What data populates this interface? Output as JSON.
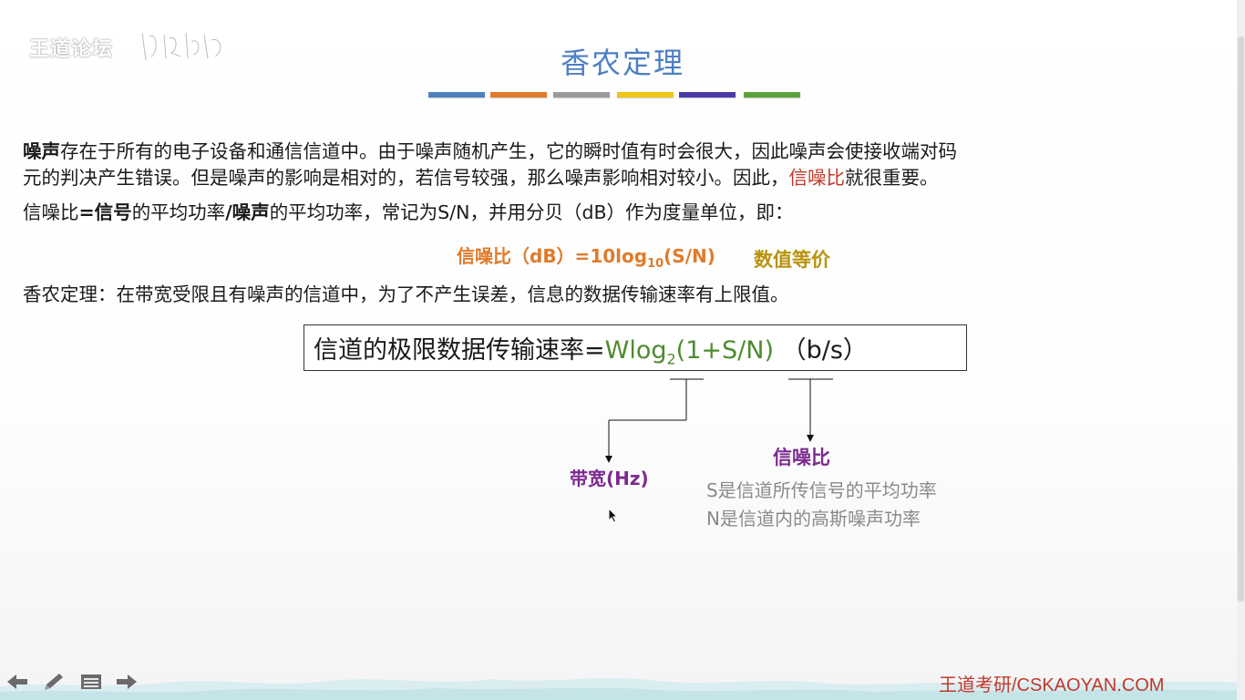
{
  "watermark": {
    "text": "王道论坛"
  },
  "title": "香农定理",
  "title_bar_colors": [
    "#4f81bd",
    "#e07b2a",
    "#9b9b9b",
    "#f0c419",
    "#4a3ca8",
    "#5ba33b"
  ],
  "paragraph1": {
    "term": "噪声",
    "rest_line1": "存在于所有的电子设备和通信信道中。由于噪声随机产生，它的瞬时值有时会很大，因此噪声会使接收端对码",
    "line2_pre": "元的判决产生错误。但是噪声的影响是相对的，若信号较强，那么噪声影响相对较小。因此，",
    "line2_highlight": "信噪比",
    "line2_post": "就很重要。"
  },
  "paragraph2": {
    "p1": "信噪比",
    "b1": "=信号",
    "p2": "的平均功率",
    "b2": "/噪声",
    "p3": "的平均功率，常记为S/N，并用分贝（dB）作为度量单位，即："
  },
  "formula_db": {
    "main": "信噪比（dB）=10log",
    "sub": "10",
    "tail": "(S/N)"
  },
  "equivalent_label": "数值等价",
  "paragraph3": "香农定理：在带宽受限且有噪声的信道中，为了不产生误差，信息的数据传输速率有上限值。",
  "shannon_formula": {
    "prefix": "信道的极限数据传输速率=",
    "w": "Wlog",
    "sub": "2",
    "arg": "(1+S/N)",
    "unit": "（b/s）"
  },
  "annotations": {
    "bandwidth": "带宽(Hz)",
    "snr": "信噪比",
    "s_desc": "S是信道所传信号的平均功率",
    "n_desc": "N是信道内的高斯噪声功率"
  },
  "footer": {
    "brand": "王道考研/CSKAOYAN.COM"
  },
  "nav_icons": [
    "back-arrow-icon",
    "pen-icon",
    "menu-icon",
    "forward-arrow-icon"
  ],
  "colors": {
    "title": "#4d7fc4",
    "highlight_red": "#c0392b",
    "formula_orange": "#e07b2a",
    "formula_green": "#4e8b2f",
    "label_purple": "#7b2a8e",
    "equiv_gold": "#b8930f"
  }
}
